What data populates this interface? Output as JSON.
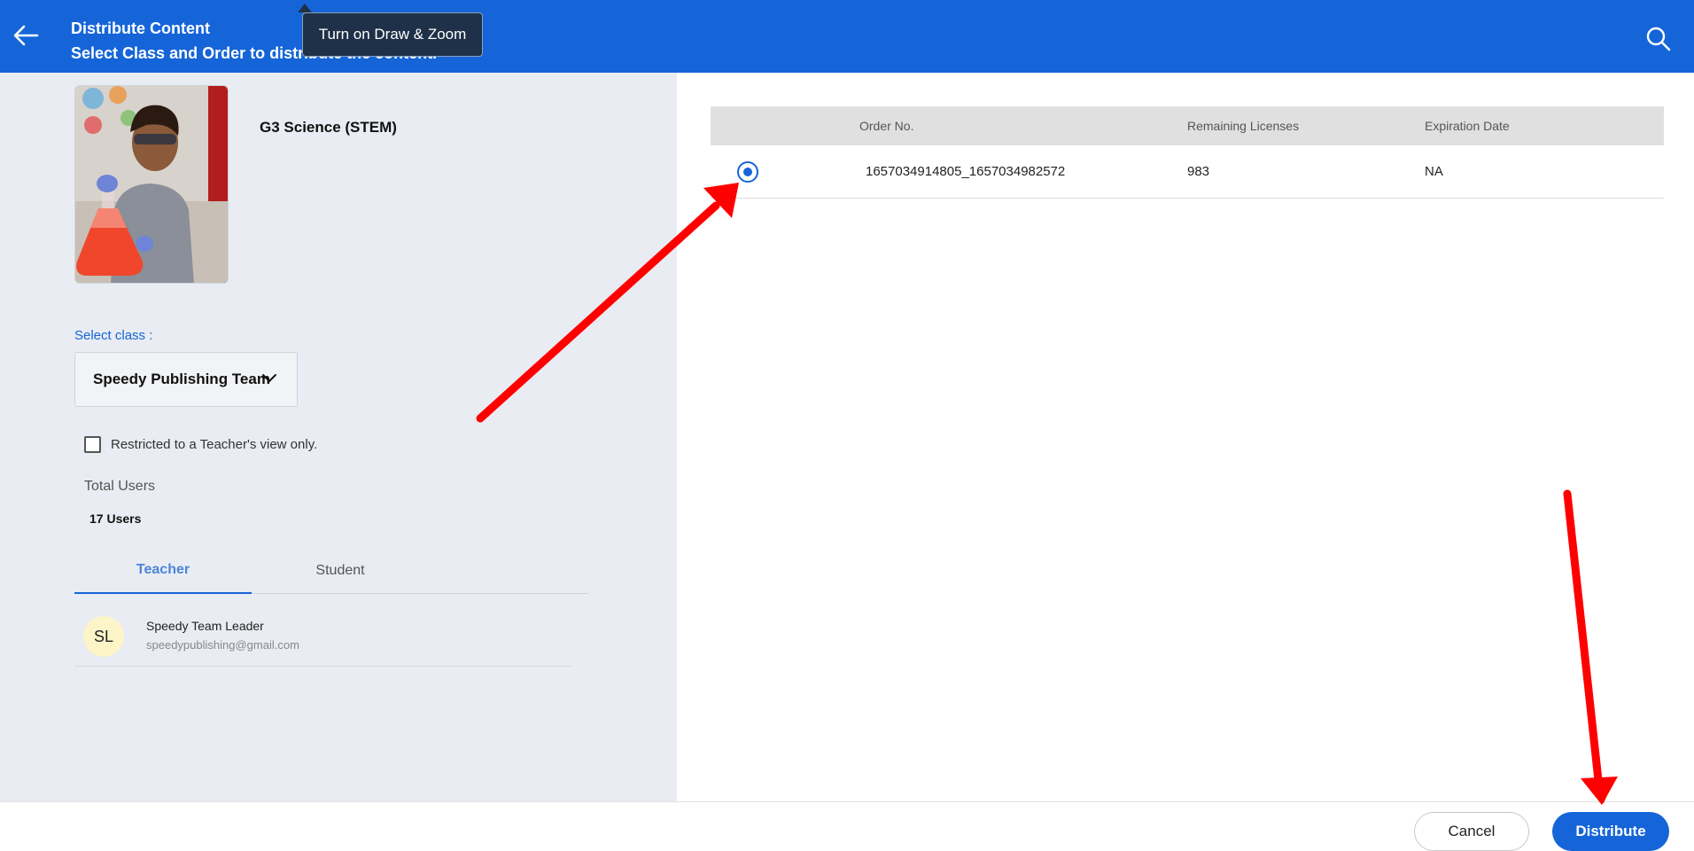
{
  "header": {
    "title": "Distribute Content",
    "subtitle": "Select Class and Order to distribute the content.",
    "back_icon": "arrow-left-icon",
    "search_icon": "search-icon",
    "tooltip": "Turn on Draw & Zoom"
  },
  "product": {
    "title": "G3 Science (STEM)"
  },
  "class_select": {
    "label": "Select class :",
    "value": "Speedy Publishing Team"
  },
  "restriction": {
    "label": "Restricted to a Teacher's view only.",
    "checked": false
  },
  "total_users": {
    "label": "Total Users",
    "value": "17 Users"
  },
  "tabs": [
    {
      "label": "Teacher",
      "active": true
    },
    {
      "label": "Student",
      "active": false
    }
  ],
  "members": [
    {
      "initials": "SL",
      "name": "Speedy Team Leader",
      "email": "speedypublishing@gmail.com"
    }
  ],
  "orders": {
    "columns": [
      "Order No.",
      "Remaining Licenses",
      "Expiration Date"
    ],
    "rows": [
      {
        "order_no": "1657034914805_1657034982572",
        "remaining": "983",
        "expiration": "NA",
        "selected": true
      }
    ]
  },
  "footer": {
    "cancel_label": "Cancel",
    "distribute_label": "Distribute"
  },
  "colors": {
    "primary": "#1565d8",
    "annotation_arrow": "#ff0000",
    "avatar_bg": "#fdf4c8"
  }
}
